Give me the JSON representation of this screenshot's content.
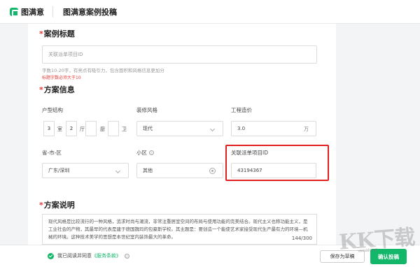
{
  "header": {
    "logo_text": "图满意",
    "page_title": "图满意案例投稿",
    "brand_color": "#12b76a"
  },
  "case_title": {
    "section_label": "案例标题",
    "required_mark": "*",
    "input_placeholder": "关联派单项目ID",
    "hint": "字数10-20字，有亮点有吸引力，包含面积和风格信息更加分",
    "error": "标题字数必须大于10"
  },
  "plan_info": {
    "section_label": "方案信息",
    "required_mark": "*",
    "layout": {
      "label": "户型结构",
      "rooms": "3",
      "rooms_unit": "室",
      "halls": "2",
      "halls_unit": "厅",
      "kitchens": "",
      "kitchens_unit": "厨",
      "baths": "",
      "baths_unit": "卫"
    },
    "style": {
      "label": "装修风格",
      "value": "现代",
      "icon": "chevron-down-icon"
    },
    "cost": {
      "label": "工程造价",
      "value": "3.0",
      "unit": "万"
    },
    "region": {
      "label": "省-市-区",
      "value": "广东/深圳",
      "icon": "chevron-down-icon"
    },
    "community": {
      "label": "小区",
      "value": "其他",
      "info_icon": "ⓘ",
      "icon": "target-icon"
    },
    "project_id": {
      "label": "关联派单项目ID",
      "value": "43194367",
      "highlight_color": "#e02020"
    }
  },
  "plan_desc": {
    "section_label": "方案说明",
    "required_mark": "*",
    "text": "现代风格是比较流行的一种风格，追求时尚与潮流，非常注重居室空间的布局与使用功能的完美结合。现代主义也称功能主义，是工业社会的产物，其最早的代表是建于德国魏玛的包豪斯学校。其主题是：要创造一个能使艺术家接受现代生产最有力的环境—机械的环境。这种技术美学的思想是本世纪室内装饰最大的革命。",
    "counter": "144/300"
  },
  "footer": {
    "agree_text": "我已阅读并同意",
    "agree_link": "《服务条款》",
    "draft_button": "保存为草稿",
    "submit_button": "确认投稿"
  },
  "watermark": {
    "text": "KK下载",
    "sub": "www.kkx.net"
  }
}
